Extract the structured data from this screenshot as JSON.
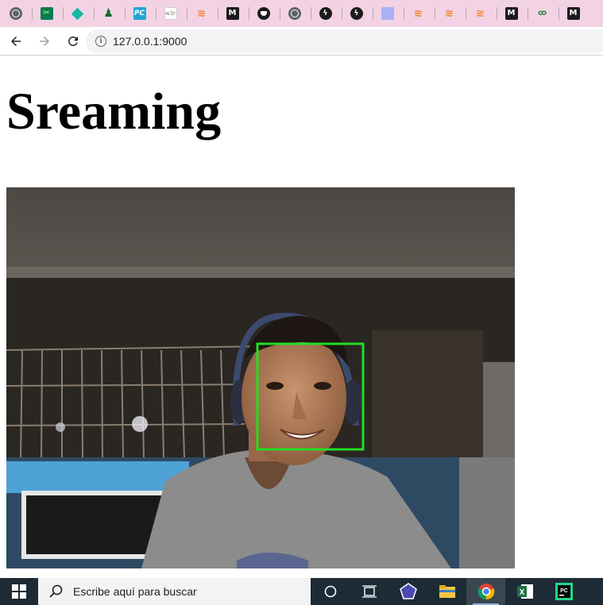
{
  "bookmarks": [
    {
      "icon": "globe-icon",
      "glyph": ""
    },
    {
      "icon": "scissors-icon",
      "glyph": "✂"
    },
    {
      "icon": "diamond-icon",
      "glyph": ""
    },
    {
      "icon": "android-icon",
      "glyph": "♟"
    },
    {
      "icon": "pc-icon",
      "glyph": "PC"
    },
    {
      "icon": "w3resource-icon",
      "glyph": "w3r"
    },
    {
      "icon": "stackoverflow-icon",
      "glyph": "≋"
    },
    {
      "icon": "medium-icon",
      "glyph": "M"
    },
    {
      "icon": "shield-icon",
      "glyph": ""
    },
    {
      "icon": "globe-icon",
      "glyph": ""
    },
    {
      "icon": "bolt-icon",
      "glyph": "ϟ"
    },
    {
      "icon": "bolt-icon",
      "glyph": "ϟ"
    },
    {
      "icon": "square-icon",
      "glyph": ""
    },
    {
      "icon": "stackoverflow-icon",
      "glyph": "≋"
    },
    {
      "icon": "stackoverflow-icon",
      "glyph": "≋"
    },
    {
      "icon": "stackoverflow-icon",
      "glyph": "≋"
    },
    {
      "icon": "medium-icon",
      "glyph": "M"
    },
    {
      "icon": "geeksforgeeks-icon",
      "glyph": "ꝏ"
    },
    {
      "icon": "medium-icon",
      "glyph": "M"
    }
  ],
  "browser": {
    "url": "127.0.0.1:9000"
  },
  "page": {
    "title": "Sreaming"
  },
  "video": {
    "face_box_color": "#22dd22"
  },
  "taskbar": {
    "search_placeholder": "Escribe aquí para buscar"
  },
  "colors": {
    "bookmarks_bg": "#f3d3e3",
    "taskbar_bg": "#1d2b36"
  }
}
